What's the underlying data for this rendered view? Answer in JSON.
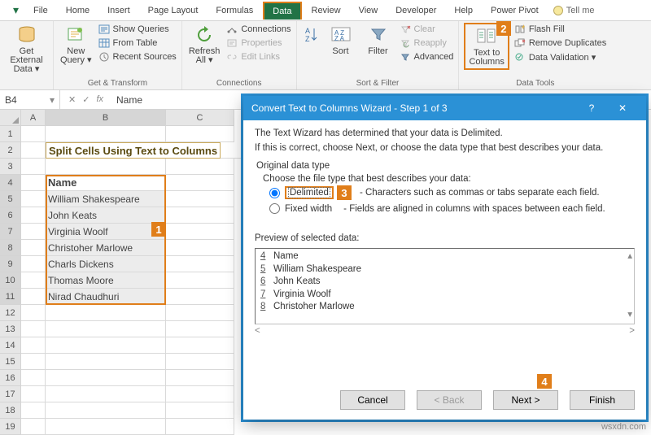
{
  "tabs": {
    "file": "File",
    "home": "Home",
    "insert": "Insert",
    "pagelayout": "Page Layout",
    "formulas": "Formulas",
    "data": "Data",
    "review": "Review",
    "view": "View",
    "developer": "Developer",
    "help": "Help",
    "powerpivot": "Power Pivot",
    "tellme": "Tell me"
  },
  "ribbon": {
    "get_external_data": "Get External\nData ▾",
    "new_query": "New\nQuery ▾",
    "show_queries": "Show Queries",
    "from_table": "From Table",
    "recent_sources": "Recent Sources",
    "group_get_transform": "Get & Transform",
    "refresh_all": "Refresh\nAll ▾",
    "connections": "Connections",
    "properties": "Properties",
    "edit_links": "Edit Links",
    "group_connections": "Connections",
    "sort": "Sort",
    "filter": "Filter",
    "clear": "Clear",
    "reapply": "Reapply",
    "advanced": "Advanced",
    "group_sort_filter": "Sort & Filter",
    "text_to_columns": "Text to\nColumns",
    "flash_fill": "Flash Fill",
    "remove_duplicates": "Remove Duplicates",
    "data_validation": "Data Validation  ▾",
    "group_data_tools": "Data Tools"
  },
  "formula_bar": {
    "cellref": "B4",
    "fx": "fx",
    "value": "Name"
  },
  "grid": {
    "cols": [
      "A",
      "B",
      "C"
    ],
    "title": "Split Cells Using Text to Columns",
    "header": "Name",
    "names": [
      "William Shakespeare",
      "John Keats",
      "Virginia Woolf",
      "Christoher Marlowe",
      "Charls Dickens",
      "Thomas Moore",
      "Nirad Chaudhuri"
    ]
  },
  "dialog": {
    "title": "Convert Text to Columns Wizard - Step 1 of 3",
    "line1": "The Text Wizard has determined that your data is Delimited.",
    "line2": "If this is correct, choose Next, or choose the data type that best describes your data.",
    "original_data_type": "Original data type",
    "choose_line": "Choose the file type that best describes your data:",
    "opt_delimited": "Delimited",
    "opt_delimited_desc": "- Characters such as commas or tabs separate each field.",
    "opt_fixed": "Fixed width",
    "opt_fixed_desc": "- Fields are aligned in columns with spaces between each field.",
    "preview_label": "Preview of selected data:",
    "preview_rows": [
      {
        "n": "4",
        "t": "Name"
      },
      {
        "n": "5",
        "t": "William Shakespeare"
      },
      {
        "n": "6",
        "t": "John Keats"
      },
      {
        "n": "7",
        "t": "Virginia Woolf"
      },
      {
        "n": "8",
        "t": "Christoher Marlowe"
      }
    ],
    "btn_cancel": "Cancel",
    "btn_back": "< Back",
    "btn_next": "Next >",
    "btn_finish": "Finish"
  },
  "steps": {
    "1": "1",
    "2": "2",
    "3": "3",
    "4": "4"
  },
  "watermark": "wsxdn.com"
}
